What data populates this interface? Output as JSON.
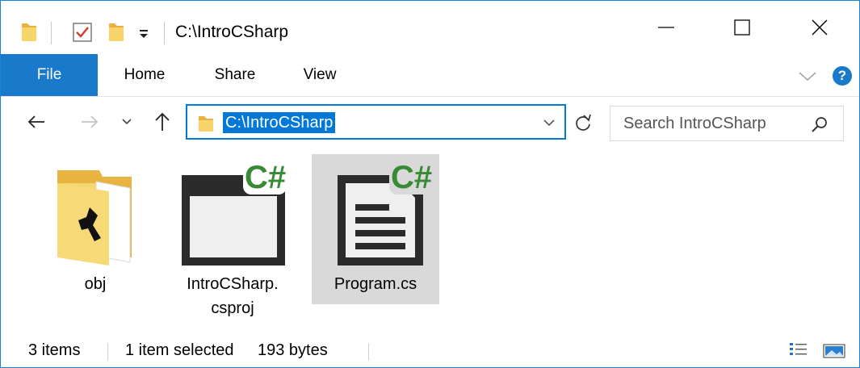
{
  "window": {
    "title": "C:\\IntroCSharp",
    "controls": {
      "minimize": "—",
      "maximize": "☐",
      "close": "✕"
    }
  },
  "ribbon": {
    "tabs": [
      {
        "label": "File",
        "active": true
      },
      {
        "label": "Home"
      },
      {
        "label": "Share"
      },
      {
        "label": "View"
      }
    ],
    "help_label": "?"
  },
  "nav": {
    "address": "C:\\IntroCSharp",
    "search_placeholder": "Search IntroCSharp"
  },
  "items": [
    {
      "name": "obj",
      "type": "folder-icon"
    },
    {
      "name": "IntroCSharp.\ncsproj",
      "line1": "IntroCSharp.",
      "line2": "csproj",
      "type": "csharp-project-icon"
    },
    {
      "name": "Program.cs",
      "type": "csharp-file-icon",
      "selected": true
    }
  ],
  "status": {
    "count": "3 items",
    "selected": "1 item selected",
    "size": "193 bytes"
  },
  "colors": {
    "accent": "#1979ca",
    "selection": "#0078d7",
    "csharp_green": "#388a34",
    "folder": "#f5d16e"
  }
}
